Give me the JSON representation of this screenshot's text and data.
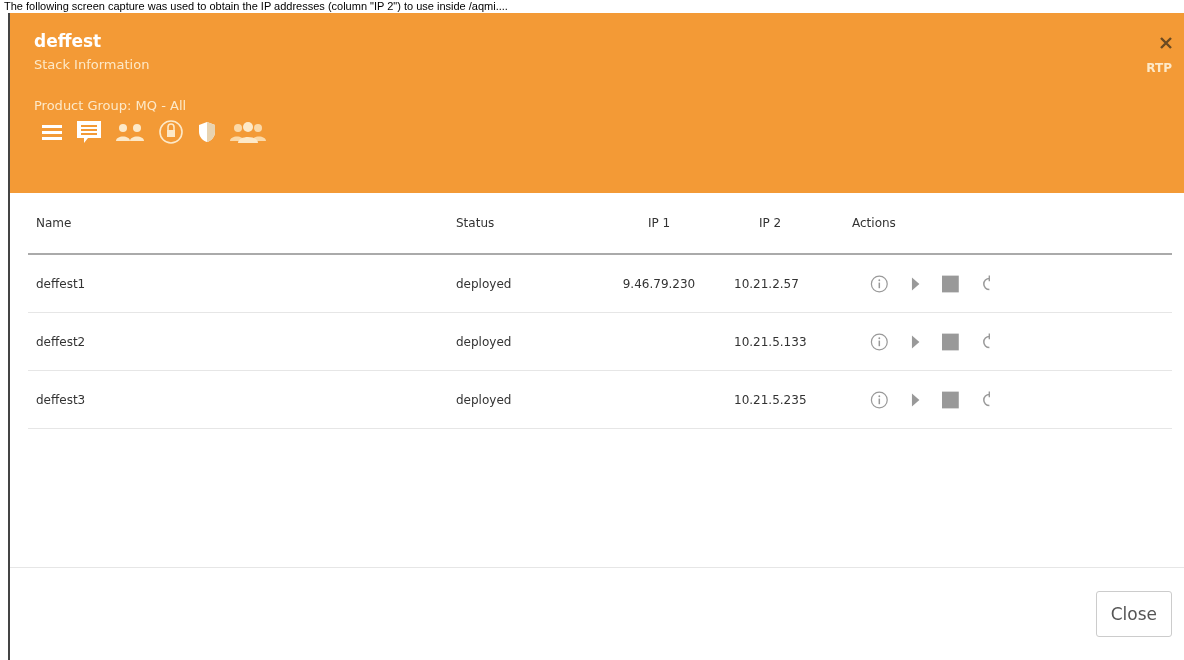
{
  "caption": "The following screen capture was used to obtain the IP addresses (column \"IP 2\") to use inside /aqmi....",
  "header": {
    "title": "deffest",
    "subtitle": "Stack Information",
    "region": "RTP",
    "product_group": "Product Group: MQ - All"
  },
  "table": {
    "columns": [
      "Name",
      "Status",
      "IP 1",
      "IP 2",
      "Actions"
    ],
    "rows": [
      {
        "name": "deffest1",
        "status": "deployed",
        "ip1": "9.46.79.230",
        "ip2": "10.21.2.57"
      },
      {
        "name": "deffest2",
        "status": "deployed",
        "ip2": "10.21.5.133"
      },
      {
        "name": "deffest3",
        "status": "deployed",
        "ip2": "10.21.5.235"
      }
    ]
  },
  "buttons": [
    "Close"
  ]
}
